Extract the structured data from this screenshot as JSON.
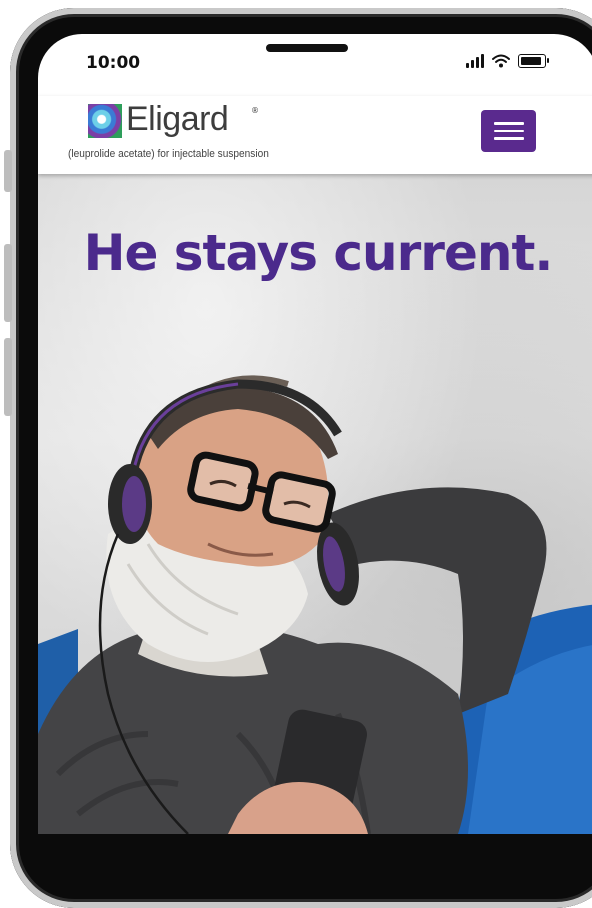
{
  "status_bar": {
    "time": "10:00"
  },
  "header": {
    "logo_name": "Eligard",
    "logo_registered": "®",
    "logo_subtitle": "(leuprolide acetate) for injectable suspension",
    "menu_icon": "hamburger-menu-icon"
  },
  "hero": {
    "headline": "He stays current."
  },
  "colors": {
    "brand_purple": "#4b2a8c",
    "menu_button": "#5a2a8e",
    "phone_frame": "#0b0b0b"
  }
}
